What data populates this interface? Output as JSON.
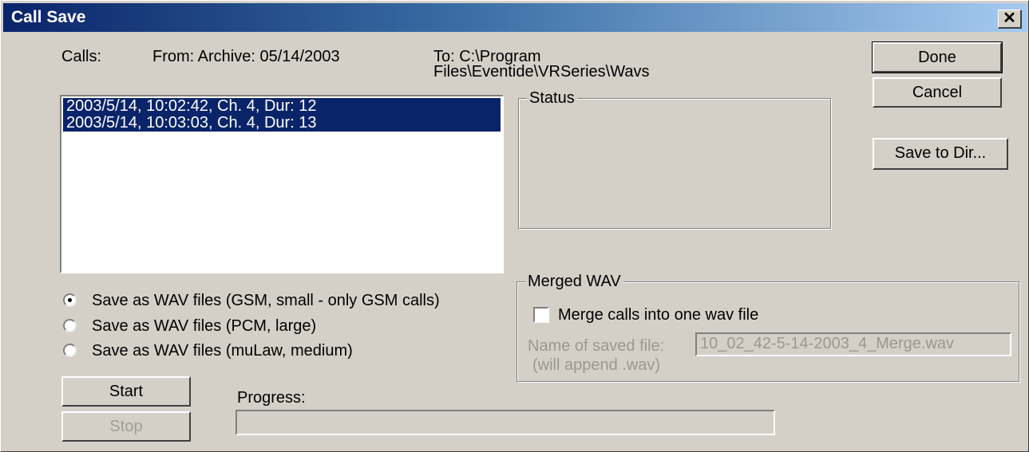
{
  "window": {
    "title": "Call Save",
    "close_glyph": "✕"
  },
  "header": {
    "calls_label": "Calls:",
    "from_text": "From: Archive: 05/14/2003",
    "to_line1": "To: C:\\Program",
    "to_line2": "Files\\Eventide\\VRSeries\\Wavs"
  },
  "buttons": {
    "done": "Done",
    "cancel": "Cancel",
    "save_to_dir": "Save to Dir...",
    "start": "Start",
    "stop": "Stop"
  },
  "calls_list": {
    "items": [
      "2003/5/14, 10:02:42, Ch. 4, Dur: 12",
      "2003/5/14, 10:03:03, Ch. 4, Dur: 13"
    ],
    "selected_color": "#0a246a"
  },
  "status_group": {
    "label": "Status"
  },
  "save_format": {
    "options": [
      "Save as WAV files (GSM, small - only GSM calls)",
      "Save as WAV files (PCM, large)",
      "Save as WAV files (muLaw, medium)"
    ],
    "selected_index": 0
  },
  "merged_wav": {
    "label": "Merged WAV",
    "checkbox_label": "Merge calls into one wav file",
    "checkbox_checked": false,
    "name_label": "Name of saved file:",
    "name_hint": "(will append .wav)",
    "name_value": "10_02_42-5-14-2003_4_Merge.wav"
  },
  "progress": {
    "label": "Progress:",
    "value": 0
  },
  "colors": {
    "face": "#d4d0c8",
    "title_start": "#0a246a",
    "title_end": "#a6caf0",
    "disabled_text": "#9a988f"
  }
}
